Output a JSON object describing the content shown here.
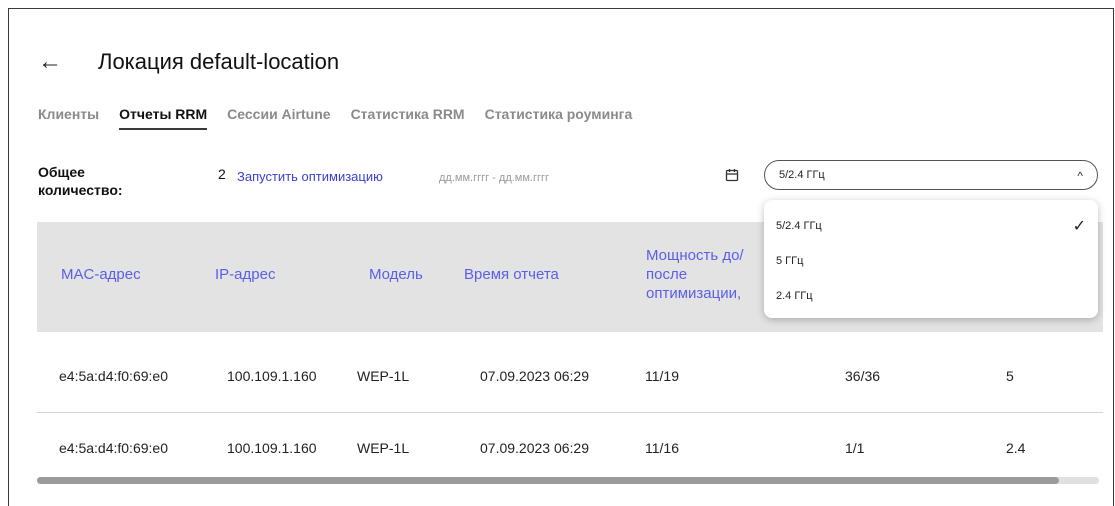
{
  "header": {
    "back_icon": "←",
    "title": "Локация default-location"
  },
  "tabs": [
    {
      "label": "Клиенты",
      "active": false
    },
    {
      "label": "Отчеты RRM",
      "active": true
    },
    {
      "label": "Сессии Airtune",
      "active": false
    },
    {
      "label": "Статистика RRM",
      "active": false
    },
    {
      "label": "Статистика роуминга",
      "active": false
    }
  ],
  "toolbar": {
    "total_label": "Общее количество:",
    "total_value": "2",
    "run_optimization": "Запустить оптимизацию",
    "date_placeholder": "дд.мм.гггг - дд.мм.гггг",
    "calendar_icon": "calendar-icon",
    "band_select_value": "5/2.4 ГГц",
    "chevron_icon": "^"
  },
  "dropdown": {
    "options": [
      {
        "label": "5/2.4 ГГц",
        "selected": true
      },
      {
        "label": "5 ГГц",
        "selected": false
      },
      {
        "label": "2.4 ГГц",
        "selected": false
      }
    ],
    "check_icon": "✓"
  },
  "table": {
    "columns": [
      "MAC-адрес",
      "IP-адрес",
      "Модель",
      "Время отчета",
      "Мощность до/после оптимизации,"
    ],
    "rows": [
      [
        "e4:5a:d4:f0:69:e0",
        "100.109.1.160",
        "WEP-1L",
        "07.09.2023 06:29",
        "11/19",
        "36/36",
        "5"
      ],
      [
        "e4:5a:d4:f0:69:e0",
        "100.109.1.160",
        "WEP-1L",
        "07.09.2023 06:29",
        "11/16",
        "1/1",
        "2.4"
      ]
    ]
  },
  "colors": {
    "accent": "#5b5ee8",
    "link": "#3b3fd6",
    "header_bg": "#e3e3e3"
  }
}
